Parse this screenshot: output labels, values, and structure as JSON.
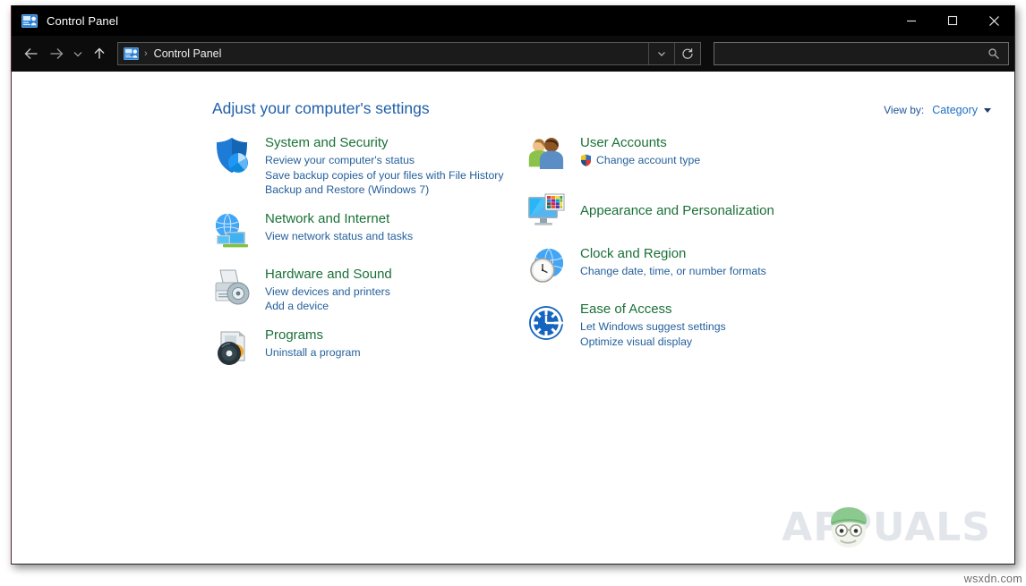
{
  "window": {
    "title": "Control Panel",
    "icon": "control-panel-icon",
    "minimize_label": "—",
    "maximize_label": "□",
    "close_label": "✕"
  },
  "toolbar": {
    "back_icon": "arrow-left-icon",
    "forward_icon": "arrow-right-icon",
    "recent_icon": "chevron-down-icon",
    "up_icon": "arrow-up-icon",
    "breadcrumb_icon": "control-panel-icon",
    "breadcrumb_separator": "›",
    "breadcrumb_text": "Control Panel",
    "dropdown_icon": "chevron-down-icon",
    "refresh_icon": "refresh-icon",
    "search_value": "",
    "search_placeholder": "",
    "search_icon": "search-icon"
  },
  "main": {
    "page_title": "Adjust your computer's settings",
    "view_by_label": "View by:",
    "view_by_value": "Category",
    "view_by_caret": "chevron-down-icon"
  },
  "categories": {
    "left": [
      {
        "icon": "shield-security-icon",
        "title": "System and Security",
        "links": [
          {
            "text": "Review your computer's status",
            "shield": false
          },
          {
            "text": "Save backup copies of your files with File History",
            "shield": false
          },
          {
            "text": "Backup and Restore (Windows 7)",
            "shield": false
          }
        ]
      },
      {
        "icon": "network-globe-icon",
        "title": "Network and Internet",
        "links": [
          {
            "text": "View network status and tasks",
            "shield": false
          }
        ]
      },
      {
        "icon": "printer-hardware-icon",
        "title": "Hardware and Sound",
        "links": [
          {
            "text": "View devices and printers",
            "shield": false
          },
          {
            "text": "Add a device",
            "shield": false
          }
        ]
      },
      {
        "icon": "programs-disc-icon",
        "title": "Programs",
        "links": [
          {
            "text": "Uninstall a program",
            "shield": false
          }
        ]
      }
    ],
    "right": [
      {
        "icon": "user-accounts-icon",
        "title": "User Accounts",
        "links": [
          {
            "text": "Change account type",
            "shield": true
          }
        ]
      },
      {
        "icon": "appearance-monitor-icon",
        "title": "Appearance and Personalization",
        "links": []
      },
      {
        "icon": "clock-region-icon",
        "title": "Clock and Region",
        "links": [
          {
            "text": "Change date, time, or number formats",
            "shield": false
          }
        ]
      },
      {
        "icon": "ease-of-access-icon",
        "title": "Ease of Access",
        "links": [
          {
            "text": "Let Windows suggest settings",
            "shield": false
          },
          {
            "text": "Optimize visual display",
            "shield": false
          }
        ]
      }
    ]
  },
  "watermark": {
    "text": "APPUALS",
    "mascot": "appuals-mascot-icon"
  },
  "site_tag": "wsxdn.com",
  "colors": {
    "titlebar_bg": "#000000",
    "toolbar_bg": "#0c0c0c",
    "category_title": "#1a7038",
    "link": "#25609c",
    "page_title": "#1f5faa",
    "content_bg": "#ffffff"
  }
}
